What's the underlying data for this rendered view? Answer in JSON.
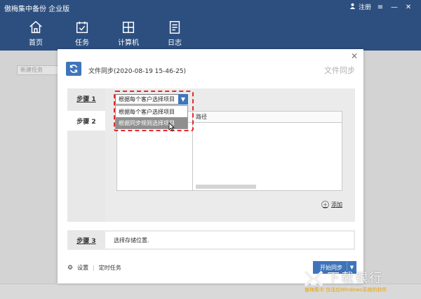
{
  "app": {
    "title": "傲梅集中备份 企业版"
  },
  "window": {
    "register_label": "注册"
  },
  "nav": {
    "items": [
      {
        "label": "首页",
        "icon": "home-icon"
      },
      {
        "label": "任务",
        "icon": "task-icon"
      },
      {
        "label": "计算机",
        "icon": "computer-icon"
      },
      {
        "label": "日志",
        "icon": "log-icon"
      }
    ]
  },
  "background": {
    "new_task_placeholder": "新建任务"
  },
  "modal": {
    "title": "文件同步(2020-08-19 15-46-25)",
    "type_label": "文件同步",
    "step1": {
      "label": "步骤 1",
      "selected_option": "根据每个客户选择项目",
      "options": [
        "根据每个客户选择项目",
        "根据同步规则选择项目"
      ],
      "highlighted_index": 1
    },
    "step2": {
      "label": "步骤 2",
      "col_path": "路径",
      "add_label": "添加"
    },
    "step3": {
      "label": "步骤 3",
      "text": "选择存储位置."
    },
    "footer": {
      "settings_label": "设置",
      "schedule_label": "定时任务",
      "start_button": "开始同步"
    }
  },
  "watermark": {
    "text": "下载银行",
    "subtext": "傲梅集中 仅适应Windows系统的软件"
  },
  "colors": {
    "topbar": "#2c4f7f",
    "accent": "#3f74ba",
    "highlight": "#e8262a"
  }
}
